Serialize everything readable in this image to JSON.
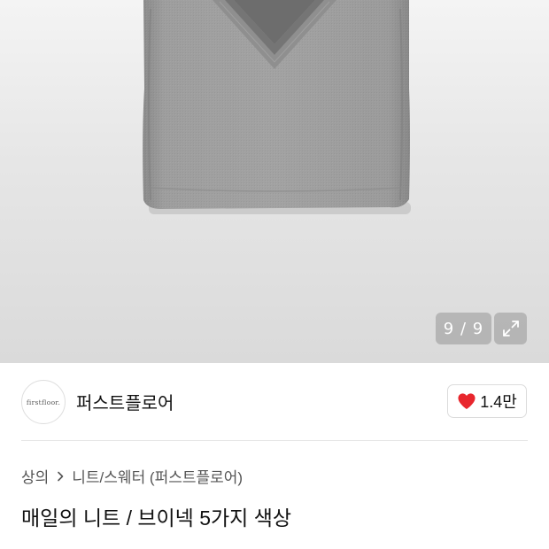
{
  "gallery": {
    "counter": "9 / 9",
    "expand_icon": "expand-arrows-icon"
  },
  "brand": {
    "logo_text": "firstfloor.",
    "name": "퍼스트플로어"
  },
  "like": {
    "icon": "heart-icon",
    "count": "1.4만",
    "heart_color": "#e8262d"
  },
  "breadcrumb": {
    "category": "상의",
    "subcategory": "니트/스웨터 (퍼스트플로어)"
  },
  "product": {
    "title": "매일의 니트 / 브이넥 5가지 색상"
  }
}
